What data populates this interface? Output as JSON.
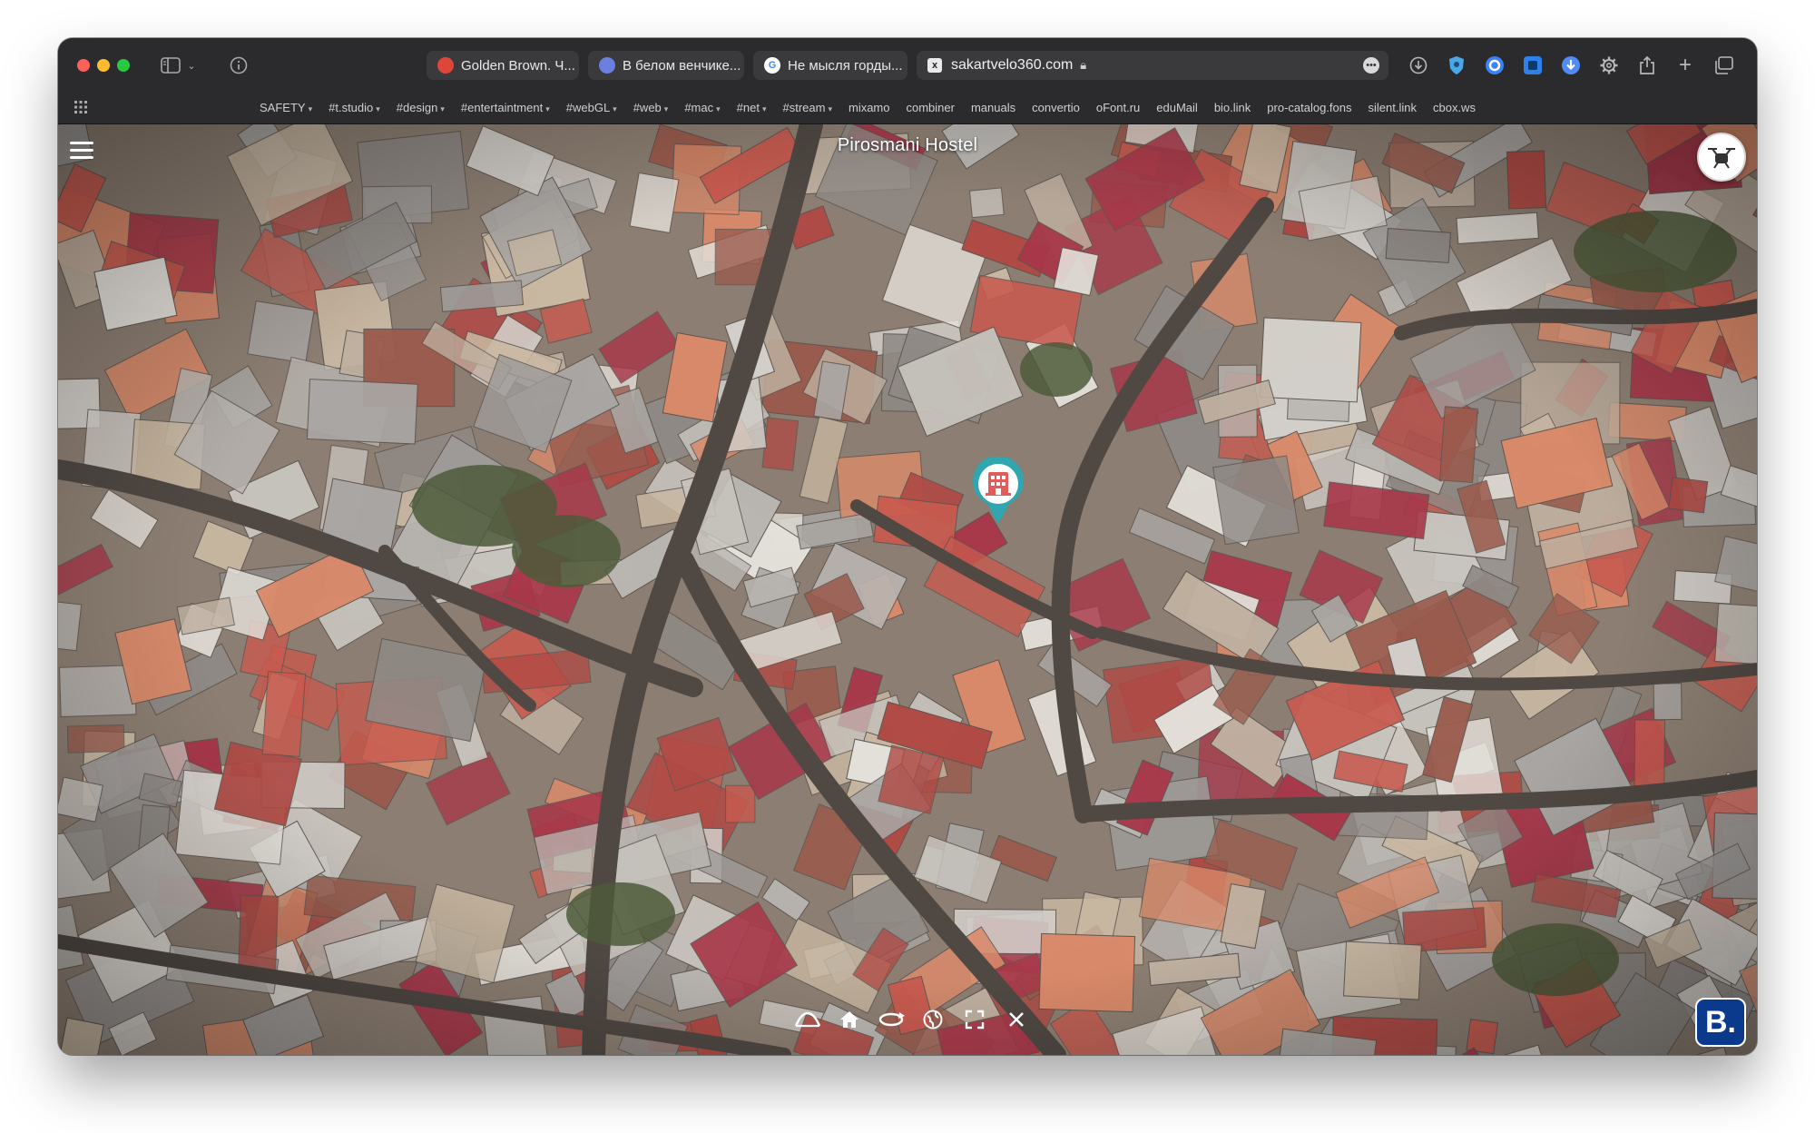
{
  "browser": {
    "tabs": [
      {
        "title": "Golden Brown. Ч...",
        "favicon": "red-bubble-icon",
        "color": "#e0453a"
      },
      {
        "title": "В белом венчике...",
        "favicon": "person-icon",
        "color": "#6b7fe0"
      },
      {
        "title": "Не мысля горды...",
        "favicon": "google-icon",
        "color": "#ffffff"
      }
    ],
    "address": {
      "url": "sakartvelo360.com",
      "favicon_letter": "x"
    },
    "toolbar_icons": [
      "download-icon",
      "shield-extension-icon",
      "circle-extension-icon",
      "square-extension-icon",
      "save-extension-icon",
      "gear-icon",
      "share-icon",
      "new-tab-icon",
      "tab-overview-icon"
    ]
  },
  "bookmarks": [
    {
      "label": "SAFETY",
      "folder": true
    },
    {
      "label": "#t.studio",
      "folder": true
    },
    {
      "label": "#design",
      "folder": true
    },
    {
      "label": "#entertaintment",
      "folder": true
    },
    {
      "label": "#webGL",
      "folder": true
    },
    {
      "label": "#web",
      "folder": true
    },
    {
      "label": "#mac",
      "folder": true
    },
    {
      "label": "#net",
      "folder": true
    },
    {
      "label": "#stream",
      "folder": true
    },
    {
      "label": "mixamo",
      "folder": false
    },
    {
      "label": "combiner",
      "folder": false
    },
    {
      "label": "manuals",
      "folder": false
    },
    {
      "label": "convertio",
      "folder": false
    },
    {
      "label": "oFont.ru",
      "folder": false
    },
    {
      "label": "eduMail",
      "folder": false
    },
    {
      "label": "bio.link",
      "folder": false
    },
    {
      "label": "pro-catalog.fons",
      "folder": false
    },
    {
      "label": "silent.link",
      "folder": false
    },
    {
      "label": "cbox.ws",
      "folder": false
    }
  ],
  "viewer": {
    "title": "Pirosmani Hostel",
    "menu_icon": "hamburger-menu-icon",
    "drone_icon": "drone-icon",
    "pin_icon": "hotel-location-pin-icon",
    "pin_color": "#2fa6b0",
    "booking_label": "B.",
    "booking_color": "#0b3a8c",
    "controls": [
      "bridge-icon",
      "home-icon",
      "rotate-icon",
      "globe-icon",
      "fullscreen-icon",
      "close-icon"
    ]
  }
}
